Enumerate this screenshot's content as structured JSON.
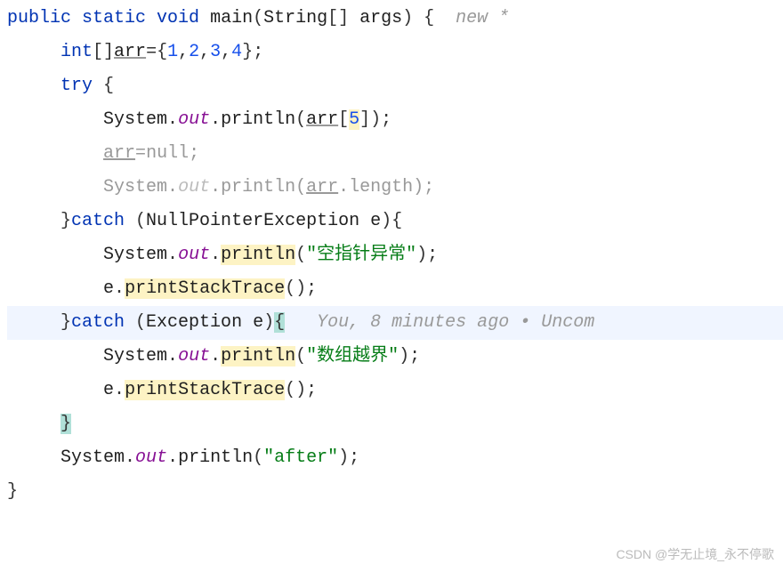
{
  "method_signature": {
    "modifiers": "public static void",
    "name": "main",
    "param_type": "String",
    "brackets": "[]",
    "param_name": "args",
    "hint": "new *"
  },
  "decl": {
    "type": "int",
    "brackets": "[]",
    "name": "arr",
    "values": [
      "1",
      "2",
      "3",
      "4"
    ]
  },
  "try_kw": "try",
  "print1": {
    "obj": "System",
    "field": "out",
    "method": "println",
    "arg_var": "arr",
    "index": "5"
  },
  "assign_null": {
    "var": "arr",
    "value": "null"
  },
  "print_len": {
    "obj": "System",
    "field": "out",
    "method": "println",
    "arg_var": "arr",
    "prop": "length"
  },
  "catch1": {
    "kw": "catch",
    "type": "NullPointerException",
    "var": "e"
  },
  "print2": {
    "obj": "System",
    "field": "out",
    "method": "println",
    "msg": "\"空指针异常\""
  },
  "stack1": {
    "var": "e",
    "method": "printStackTrace"
  },
  "catch2": {
    "kw": "catch",
    "type": "Exception",
    "var": "e",
    "blame": "You, 8 minutes ago • Uncom"
  },
  "print3": {
    "obj": "System",
    "field": "out",
    "method": "println",
    "msg": "\"数组越界\""
  },
  "stack2": {
    "var": "e",
    "method": "printStackTrace"
  },
  "print_after": {
    "obj": "System",
    "field": "out",
    "method": "println",
    "msg": "\"after\""
  },
  "watermark": "CSDN @学无止境_永不停歌"
}
